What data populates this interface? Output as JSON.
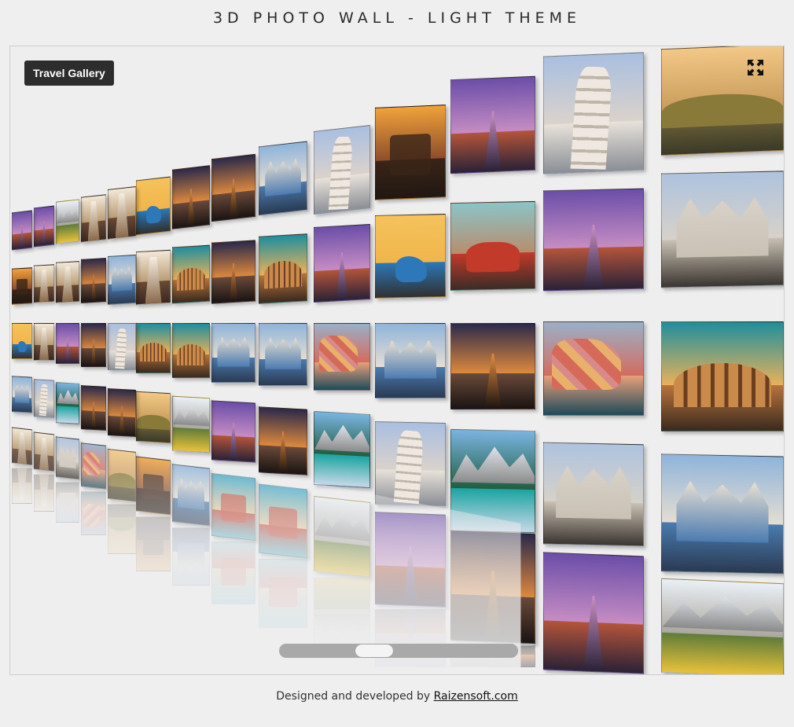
{
  "header": {
    "title": "3D PHOTO WALL - LIGHT THEME"
  },
  "viewer": {
    "gallery_label": "Travel Gallery",
    "fullscreen_icon": "expand-arrows-icon",
    "scrollbar": {
      "position": 0.38
    }
  },
  "photo_themes": {
    "venice-canal": [
      "#6b4ea8",
      "#c98fc4",
      "#b4553a",
      "#2a2236"
    ],
    "leaning-tower": [
      "#a9bfe0",
      "#dcd3cb",
      "#e8e2da",
      "#8b8f96"
    ],
    "tuscany-hills": [
      "#f3c887",
      "#c79a5a",
      "#7a6a3a",
      "#3a3a28"
    ],
    "milan-duomo": [
      "#aec3de",
      "#d8d2c9",
      "#c9c1b4",
      "#3a3530"
    ],
    "vespa-wall": [
      "#f5c25c",
      "#f0b54a",
      "#2c78b8",
      "#303030"
    ],
    "red-car": [
      "#8bc4c7",
      "#b88c6a",
      "#c23a2a",
      "#3a2c26"
    ],
    "colosseum": [
      "#1f8e9e",
      "#f0b357",
      "#b8743c",
      "#3a2a1e"
    ],
    "dusk-street": [
      "#2b2a4a",
      "#e38c3e",
      "#6a4a3a",
      "#1a1412"
    ],
    "salute-church": [
      "#8fb4da",
      "#e8dfd2",
      "#4a7bb0",
      "#2a3a52"
    ],
    "cinque-terre": [
      "#9ab0c8",
      "#d56a5a",
      "#e8a07a",
      "#1e4a5a"
    ],
    "alpine-lake": [
      "#7ab4e0",
      "#1d5a3a",
      "#1aa4a0",
      "#c8d8e8"
    ],
    "dolomites": [
      "#eaf0f6",
      "#a8a49a",
      "#5f7c3a",
      "#e8c23a"
    ],
    "old-town": [
      "#f0a23a",
      "#8a4a2a",
      "#3a2418",
      "#201812"
    ],
    "venice-water": [
      "#3ea8c8",
      "#e8c89a",
      "#c44a3a",
      "#6ab8c8"
    ],
    "hallway": [
      "#f2e8d8",
      "#b89a72",
      "#6a4a34",
      "#3a2820"
    ]
  },
  "photos": [
    "tuscany-hills",
    "leaning-tower",
    "venice-canal",
    "old-town",
    "leaning-tower",
    "salute-church",
    "dusk-street",
    "dusk-street",
    "vespa-wall",
    "hallway",
    "hallway",
    "dolomites",
    "venice-canal",
    "venice-canal",
    "milan-duomo",
    "venice-canal",
    "red-car",
    "vespa-wall",
    "venice-canal",
    "colosseum",
    "dusk-street",
    "colosseum",
    "hallway",
    "salute-church",
    "dusk-street",
    "hallway",
    "hallway",
    "old-town",
    "colosseum",
    "cinque-terre",
    "dusk-street",
    "salute-church",
    "cinque-terre",
    "salute-church",
    "salute-church",
    "colosseum",
    "colosseum",
    "leaning-tower",
    "dusk-street",
    "venice-canal",
    "hallway",
    "vespa-wall",
    "salute-church",
    "milan-duomo",
    "alpine-lake",
    "leaning-tower",
    "alpine-lake",
    "dusk-street",
    "venice-canal",
    "dolomites",
    "tuscany-hills",
    "dusk-street",
    "dusk-street",
    "alpine-lake",
    "leaning-tower",
    "salute-church",
    "dolomites",
    "venice-canal",
    "dusk-street",
    "venice-canal",
    "dolomites",
    "venice-water",
    "venice-water",
    "salute-church",
    "old-town",
    "tuscany-hills",
    "cinque-terre",
    "milan-duomo",
    "hallway",
    "hallway",
    "dusk-street"
  ],
  "footer": {
    "prefix": "Designed and developed by ",
    "link_text": "Raizensoft.com"
  }
}
